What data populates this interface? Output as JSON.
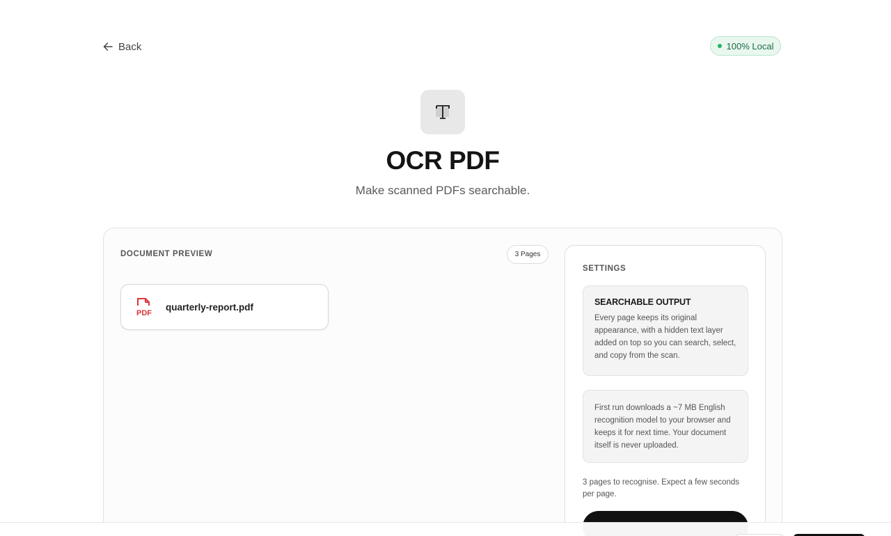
{
  "nav": {
    "back_label": "Back"
  },
  "badge": {
    "label": "100% Local",
    "dot_color": "#22b566"
  },
  "hero": {
    "icon": "text-cursor-icon",
    "icon_glyph": "T",
    "title": "OCR PDF",
    "subtitle": "Make scanned PDFs searchable."
  },
  "preview": {
    "section_label": "DOCUMENT PREVIEW",
    "page_count_label": "3 Pages",
    "file": {
      "icon": "pdf-file-icon",
      "icon_text": "PDF",
      "name": "quarterly-report.pdf"
    }
  },
  "settings": {
    "section_label": "SETTINGS",
    "output_box": {
      "title": "SEARCHABLE OUTPUT",
      "text": "Every page keeps its original appearance, with a hidden text layer added on top so you can search, select, and copy from the scan."
    },
    "model_box": {
      "text": "First run downloads a ~7 MB English recognition model to your browser and keeps it for next time. Your document itself is never uploaded."
    },
    "note": "3 pages to recognise. Expect a few seconds per page."
  },
  "colors": {
    "accent_dark": "#111111",
    "pdf_red": "#e0323a",
    "badge_bg": "#e9f7ef"
  }
}
